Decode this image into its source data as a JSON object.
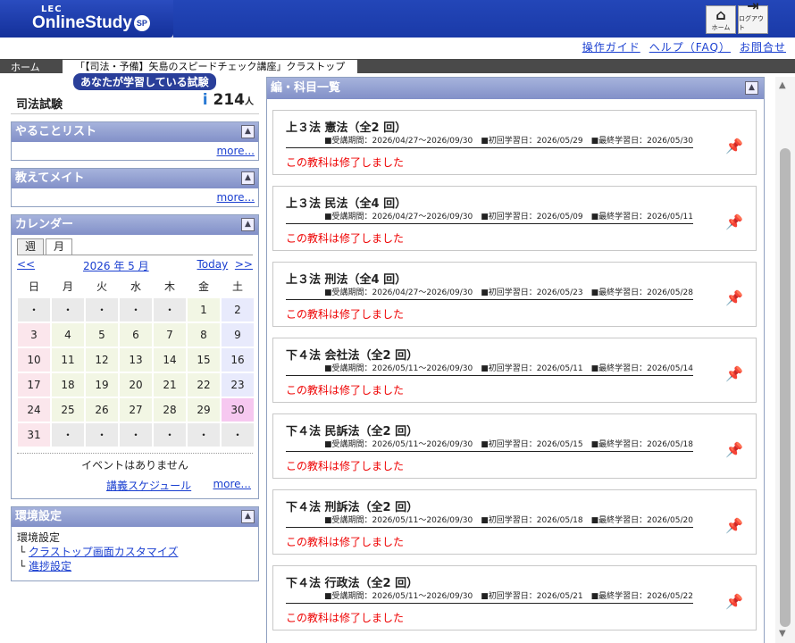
{
  "header": {
    "brand_top": "LEC",
    "brand_name": "OnlineStudy",
    "brand_badge": "SP",
    "home_label": "ホーム",
    "logout_label": "ログアウト"
  },
  "links": {
    "guide": "操作ガイド",
    "help": "ヘルプ（FAQ）",
    "contact": "お問合せ"
  },
  "breadcrumb": {
    "home": "ホーム",
    "current": "「【司法・予備】矢島のスピードチェック講座」クラストップ"
  },
  "exam": {
    "heading": "あなたが学習している試験",
    "name": "司法試験",
    "count": "214",
    "unit": "人"
  },
  "todo": {
    "title": "やることリスト",
    "more": "more..."
  },
  "mate": {
    "title": "教えてメイト",
    "more": "more..."
  },
  "calendar": {
    "title": "カレンダー",
    "tab_week": "週",
    "tab_month": "月",
    "prev": "<<",
    "month": "2026 年 5 月",
    "today": "Today",
    "next": ">>",
    "weekdays": [
      "日",
      "月",
      "火",
      "水",
      "木",
      "金",
      "土"
    ],
    "rows": [
      [
        "・",
        "・",
        "・",
        "・",
        "・",
        "1",
        "2"
      ],
      [
        "3",
        "4",
        "5",
        "6",
        "7",
        "8",
        "9"
      ],
      [
        "10",
        "11",
        "12",
        "13",
        "14",
        "15",
        "16"
      ],
      [
        "17",
        "18",
        "19",
        "20",
        "21",
        "22",
        "23"
      ],
      [
        "24",
        "25",
        "26",
        "27",
        "28",
        "29",
        "30"
      ],
      [
        "31",
        "・",
        "・",
        "・",
        "・",
        "・",
        "・"
      ]
    ],
    "no_events": "イベントはありません",
    "schedule": "講義スケジュール",
    "more": "more..."
  },
  "env": {
    "title": "環境設定",
    "label": "環境設定",
    "customize": "クラストップ画面カスタマイズ",
    "progress": "進捗設定"
  },
  "subjects": {
    "title": "編・科目一覧",
    "items": [
      {
        "title": "上３法 憲法（全2 回）",
        "meta": "■受講期間：2026/04/27～2026/09/30　■初回学習日：2026/05/29　■最終学習日：2026/05/30",
        "status": "この教科は修了しました"
      },
      {
        "title": "上３法 民法（全4 回）",
        "meta": "■受講期間：2026/04/27～2026/09/30　■初回学習日：2026/05/09　■最終学習日：2026/05/11",
        "status": "この教科は修了しました"
      },
      {
        "title": "上３法 刑法（全4 回）",
        "meta": "■受講期間：2026/04/27～2026/09/30　■初回学習日：2026/05/23　■最終学習日：2026/05/28",
        "status": "この教科は修了しました"
      },
      {
        "title": "下４法 会社法（全2 回）",
        "meta": "■受講期間：2026/05/11～2026/09/30　■初回学習日：2026/05/11　■最終学習日：2026/05/14",
        "status": "この教科は修了しました"
      },
      {
        "title": "下４法 民訴法（全2 回）",
        "meta": "■受講期間：2026/05/11～2026/09/30　■初回学習日：2026/05/15　■最終学習日：2026/05/18",
        "status": "この教科は修了しました"
      },
      {
        "title": "下４法 刑訴法（全2 回）",
        "meta": "■受講期間：2026/05/11～2026/09/30　■初回学習日：2026/05/18　■最終学習日：2026/05/20",
        "status": "この教科は修了しました"
      },
      {
        "title": "下４法 行政法（全2 回）",
        "meta": "■受講期間：2026/05/11～2026/09/30　■初回学習日：2026/05/21　■最終学習日：2026/05/22",
        "status": "この教科は修了しました"
      }
    ]
  }
}
